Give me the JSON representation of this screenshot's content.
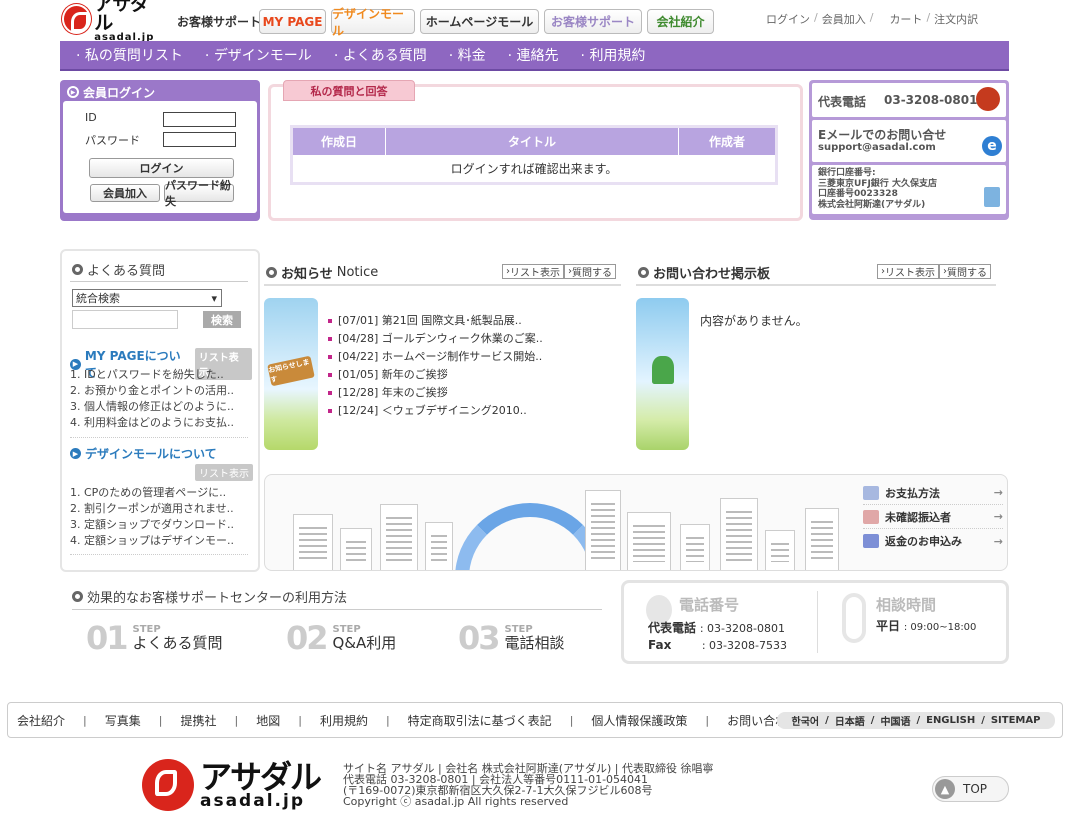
{
  "header": {
    "logo_jp": "アサダル",
    "logo_en": "asadal.jp",
    "section_title": "お客様サポート",
    "nav_buttons": [
      {
        "label": "MY PAGE",
        "color": "#e8481c"
      },
      {
        "label": "デザインモール",
        "color": "#f08a1f"
      },
      {
        "label": "ホームページモール",
        "color": "#333333"
      },
      {
        "label": "お客様サポート",
        "color": "#9a86c4"
      },
      {
        "label": "会社紹介",
        "color": "#3e8a2e"
      }
    ],
    "top_links": [
      "ログイン",
      "会員加入",
      "カート",
      "注文内訳"
    ]
  },
  "main_nav": [
    "私の質問リスト",
    "デザインモール",
    "よくある質問",
    "料金",
    "連絡先",
    "利用規約"
  ],
  "login": {
    "title": "会員ログイン",
    "id_label": "ID",
    "password_label": "パスワード",
    "login_button": "ログイン",
    "join_button": "会員加入",
    "lost_password_button": "パスワード紛失"
  },
  "qa": {
    "tab_title": "私の質問と回答",
    "columns": [
      "作成日",
      "タイトル",
      "作成者"
    ],
    "empty_message": "ログインすれば確認出来ます。"
  },
  "contact": {
    "phone_label": "代表電話",
    "phone": "03-3208-0801",
    "email_title": "Eメールでのお問い合せ",
    "email": "support@asadal.com",
    "bank_lines": [
      "銀行口座番号:",
      "三菱東京UFJ銀行 大久保支店",
      "口座番号0023328",
      "株式会社阿斯達(アサダル)"
    ]
  },
  "faq": {
    "title": "よくある質問",
    "search_select": "統合検索",
    "search_button": "検索",
    "sections": [
      {
        "title": "MY PAGEについて",
        "list_button": "リスト表示",
        "items": [
          "1. IDとパスワードを紛失した..",
          "2. お預かり金とポイントの活用..",
          "3. 個人情報の修正はどのように..",
          "4. 利用料金はどのようにお支払.."
        ]
      },
      {
        "title": "デザインモールについて",
        "list_button": "リスト表示",
        "items": [
          "1. CPのための管理者ページに..",
          "2. 割引クーポンが適用されませ..",
          "3. 定額ショップでダウンロード..",
          "4. 定額ショップはデザインモー.."
        ]
      }
    ]
  },
  "notice": {
    "title": "お知らせ",
    "title_en": "Notice",
    "list_button": "リスト表示",
    "question_button": "質問する",
    "badge": "お知らせします",
    "items": [
      "[07/01] 第21回 国際文具･紙製品展..",
      "[04/28] ゴールデンウィーク休業のご案..",
      "[04/22] ホームページ制作サービス開始..",
      "[01/05] 新年のご挨拶",
      "[12/28] 年末のご挨拶",
      "[12/24] ＜ウェブデザイニング2010.."
    ]
  },
  "inquiry": {
    "title": "お問い合わせ掲示板",
    "list_button": "リスト表示",
    "question_button": "質問する",
    "empty_message": "内容がありません。"
  },
  "banner_links": [
    "お支払方法",
    "未確認振込者",
    "返金のお申込み"
  ],
  "steps": {
    "title": "効果的なお客様サポートセンターの利用方法",
    "items": [
      {
        "num": "01",
        "step": "STEP",
        "label": "よくある質問"
      },
      {
        "num": "02",
        "step": "STEP",
        "label": "Q&A利用"
      },
      {
        "num": "03",
        "step": "STEP",
        "label": "電話相談"
      }
    ]
  },
  "tel": {
    "title": "電話番号",
    "rep_label": "代表電話",
    "rep_value": ": 03-3208-0801",
    "fax_label": "Fax",
    "fax_value": ": 03-3208-7533",
    "hours_title": "相談時間",
    "weekday_label": "平日",
    "weekday_value": ": 09:00~18:00"
  },
  "footer": {
    "links": [
      "会社紹介",
      "写真集",
      "提携社",
      "地図",
      "利用規約",
      "特定商取引法に基づく表記",
      "個人情報保護政策",
      "お問い合わせ"
    ],
    "languages": [
      "한국어",
      "日本語",
      "中国语",
      "ENGLISH",
      "SITEMAP"
    ],
    "info_lines": [
      "サイト名 アサダル | 会社名 株式会社阿斯達(アサダル) | 代表取締役 徐唱寧",
      "代表電話 03-3208-0801 | 会社法人等番号0111-01-054041",
      "(〒169-0072)東京都新宿区大久保2-7-1大久保フジビル608号",
      "Copyright ⓒ asadal.jp All rights reserved"
    ],
    "top_button": "TOP"
  }
}
